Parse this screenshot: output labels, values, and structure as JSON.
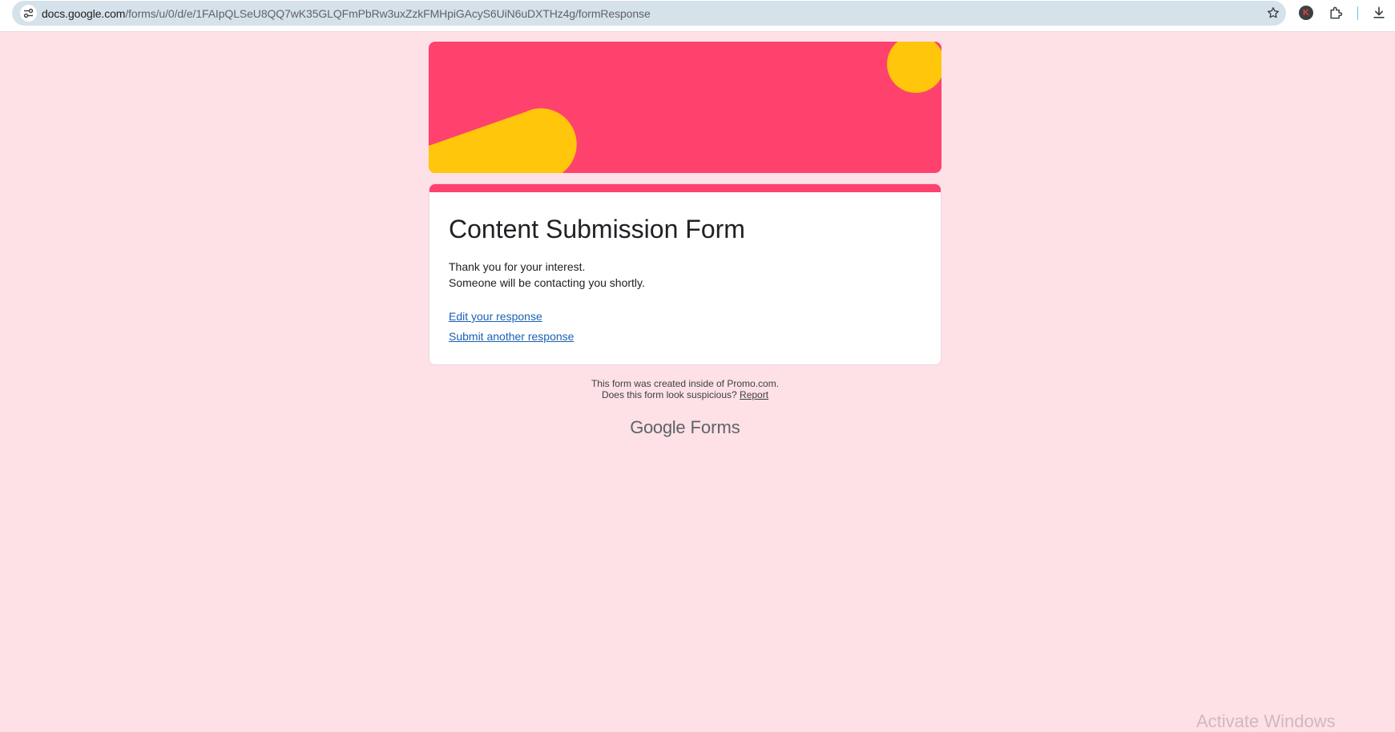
{
  "browser": {
    "url_host": "docs.google.com",
    "url_path": "/forms/u/0/d/e/1FAIpQLSeU8QQ7wK35GLQFmPbRw3uxZzkFMHpiGAcyS6UiN6uDXTHz4g/formResponse",
    "site_info_icon": "tune-icon",
    "bookmark_icon": "star-icon",
    "profile_initial": "K",
    "extensions_icon": "puzzle-icon",
    "download_icon": "download-icon"
  },
  "form": {
    "header_colors": {
      "banner": "#ff416d",
      "shapes": "#ffc60b"
    },
    "title": "Content Submission Form",
    "confirmation_line1": "Thank you for your interest.",
    "confirmation_line2": "Someone will be contacting you shortly.",
    "edit_link": "Edit your response",
    "submit_another_link": "Submit another response"
  },
  "footer": {
    "notice_line1": "This form was created inside of Promo.com.",
    "notice_line2_prefix": "Does this form look suspicious?",
    "report_link": "Report",
    "brand_google": "Google",
    "brand_forms": "Forms"
  },
  "os": {
    "watermark": "Activate Windows"
  }
}
